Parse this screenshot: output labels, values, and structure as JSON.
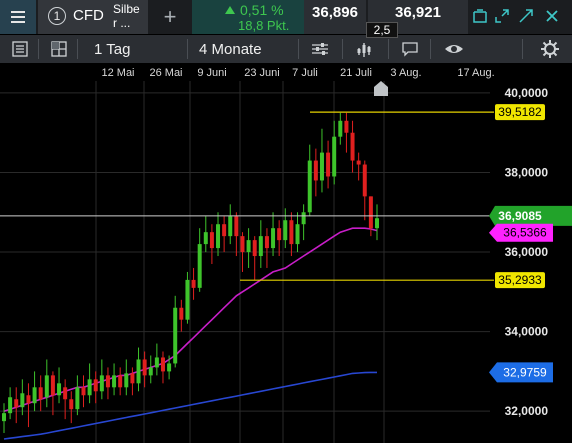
{
  "header": {
    "instrument_number": "1",
    "instrument_type": "CFD",
    "instrument_name": "Silbe\nr ...",
    "change_percent": "0,51 %",
    "change_points": "18,8 Pkt.",
    "sell_price": "36,896",
    "buy_price": "36,921",
    "spread": "2,5",
    "up_color": "#3ec74f"
  },
  "toolbar": {
    "interval": "1 Tag",
    "range": "4 Monate",
    "icons": [
      "list-icon",
      "layout-icon",
      "indicator-sliders-icon",
      "drawing-tool-icon",
      "comment-icon",
      "eye-icon",
      "settings-gear-icon"
    ]
  },
  "chart_data": {
    "type": "candlestick",
    "x_tick_labels": [
      "12 Mai",
      "26 Mai",
      "9 Juni",
      "23 Juni",
      "7 Juli",
      "21 Juli",
      "3 Aug.",
      "17 Aug."
    ],
    "y_tick_labels": [
      "40,0000",
      "38,0000",
      "36,0000",
      "34,0000",
      "32,0000"
    ],
    "y_ticks": [
      40,
      38,
      36,
      34,
      32
    ],
    "ylim": [
      31.2,
      40.3
    ],
    "price_labels": {
      "high_line": "39,5182",
      "current": "36,9085",
      "ma_fast": "36,5366",
      "low_line": "35,2933",
      "ma_slow": "32,9759"
    },
    "levels": {
      "high_line": 39.5182,
      "current": 36.9085,
      "ma_fast": 36.5366,
      "low_line": 35.2933,
      "ma_slow": 32.9759
    },
    "colors": {
      "up": "#3ec42b",
      "down": "#e0201f",
      "ma_fast": "#c81ec8",
      "ma_slow": "#2847d2",
      "level_line": "#e6d200",
      "current_label": "#22a32a",
      "ma_fast_label": "#ff22ff",
      "ma_slow_label": "#1d6de6",
      "level_label": "#f0e600"
    },
    "candles": [
      [
        31.75,
        31.95,
        31.45,
        32.2
      ],
      [
        31.95,
        32.35,
        31.8,
        32.6
      ],
      [
        32.3,
        32.1,
        31.7,
        32.6
      ],
      [
        32.1,
        32.45,
        31.9,
        32.8
      ],
      [
        32.4,
        32.2,
        31.6,
        32.7
      ],
      [
        32.2,
        32.6,
        32.0,
        33.0
      ],
      [
        32.6,
        32.3,
        32.0,
        32.9
      ],
      [
        32.35,
        32.9,
        32.1,
        33.3
      ],
      [
        32.9,
        32.4,
        31.9,
        33.0
      ],
      [
        32.4,
        32.7,
        32.2,
        33.1
      ],
      [
        32.6,
        32.3,
        31.8,
        32.8
      ],
      [
        32.3,
        32.05,
        31.7,
        32.5
      ],
      [
        32.05,
        32.6,
        31.9,
        32.9
      ],
      [
        32.6,
        32.4,
        32.1,
        32.9
      ],
      [
        32.4,
        32.8,
        32.2,
        33.2
      ],
      [
        32.8,
        32.5,
        32.2,
        33.0
      ],
      [
        32.5,
        32.9,
        32.3,
        33.3
      ],
      [
        32.9,
        32.6,
        32.3,
        33.1
      ],
      [
        32.6,
        32.9,
        32.4,
        33.2
      ],
      [
        32.9,
        32.6,
        32.4,
        33.1
      ],
      [
        32.6,
        32.95,
        32.4,
        33.3
      ],
      [
        32.95,
        32.7,
        32.4,
        33.1
      ],
      [
        32.7,
        33.3,
        32.5,
        33.6
      ],
      [
        33.3,
        32.9,
        32.6,
        33.5
      ],
      [
        32.9,
        33.1,
        32.7,
        33.4
      ],
      [
        33.1,
        33.35,
        32.9,
        33.7
      ],
      [
        33.35,
        33.0,
        32.7,
        33.5
      ],
      [
        33.0,
        33.2,
        32.8,
        33.4
      ],
      [
        33.2,
        34.6,
        33.1,
        34.9
      ],
      [
        34.6,
        34.3,
        34.0,
        34.8
      ],
      [
        34.3,
        35.3,
        34.2,
        35.5
      ],
      [
        35.3,
        35.1,
        34.8,
        35.6
      ],
      [
        35.1,
        36.2,
        35.0,
        36.6
      ],
      [
        36.2,
        36.5,
        36.0,
        36.9
      ],
      [
        36.5,
        36.1,
        35.7,
        36.7
      ],
      [
        36.1,
        36.7,
        35.9,
        37.0
      ],
      [
        36.7,
        36.4,
        36.0,
        36.9
      ],
      [
        36.4,
        36.9,
        36.2,
        37.2
      ],
      [
        36.9,
        36.4,
        35.9,
        37.0
      ],
      [
        36.4,
        36.0,
        35.5,
        36.5
      ],
      [
        36.0,
        36.3,
        35.6,
        36.6
      ],
      [
        36.3,
        35.9,
        35.3,
        36.4
      ],
      [
        35.9,
        36.4,
        35.6,
        36.8
      ],
      [
        36.4,
        36.1,
        35.6,
        36.6
      ],
      [
        36.1,
        36.6,
        35.9,
        37.0
      ],
      [
        36.6,
        36.3,
        35.9,
        36.8
      ],
      [
        36.3,
        36.8,
        36.1,
        37.1
      ],
      [
        36.8,
        36.2,
        35.9,
        37.0
      ],
      [
        36.2,
        36.7,
        36.0,
        37.0
      ],
      [
        36.7,
        37.0,
        36.3,
        37.2
      ],
      [
        37.0,
        38.3,
        36.9,
        38.7
      ],
      [
        38.3,
        37.8,
        37.4,
        38.6
      ],
      [
        37.8,
        38.5,
        37.5,
        39.1
      ],
      [
        38.5,
        37.9,
        37.6,
        38.8
      ],
      [
        37.9,
        38.9,
        37.7,
        39.3
      ],
      [
        38.9,
        39.3,
        38.7,
        39.5
      ],
      [
        39.3,
        39.0,
        38.5,
        39.5
      ],
      [
        39.0,
        38.3,
        38.0,
        39.3
      ],
      [
        38.3,
        38.2,
        37.8,
        38.5
      ],
      [
        38.2,
        37.4,
        36.8,
        38.3
      ],
      [
        37.4,
        36.6,
        36.4,
        37.4
      ],
      [
        36.6,
        36.85,
        36.3,
        37.2
      ]
    ],
    "ma_fast": [
      32.0,
      32.05,
      32.1,
      32.15,
      32.2,
      32.25,
      32.3,
      32.35,
      32.4,
      32.45,
      32.5,
      32.55,
      32.6,
      32.6,
      32.65,
      32.7,
      32.75,
      32.8,
      32.85,
      32.9,
      32.9,
      32.95,
      33.0,
      33.05,
      33.1,
      33.15,
      33.2,
      33.3,
      33.4,
      33.55,
      33.7,
      33.85,
      34.0,
      34.15,
      34.3,
      34.45,
      34.6,
      34.75,
      34.9,
      35.0,
      35.1,
      35.2,
      35.3,
      35.4,
      35.5,
      35.55,
      35.6,
      35.7,
      35.8,
      35.9,
      36.0,
      36.1,
      36.2,
      36.3,
      36.4,
      36.5,
      36.55,
      36.6,
      36.6,
      36.6,
      36.58,
      36.54
    ],
    "ma_slow": [
      31.3,
      31.32,
      31.34,
      31.36,
      31.38,
      31.4,
      31.42,
      31.45,
      31.48,
      31.51,
      31.54,
      31.57,
      31.6,
      31.63,
      31.66,
      31.69,
      31.72,
      31.75,
      31.78,
      31.81,
      31.84,
      31.87,
      31.9,
      31.93,
      31.96,
      31.99,
      32.02,
      32.05,
      32.08,
      32.11,
      32.14,
      32.17,
      32.2,
      32.23,
      32.26,
      32.29,
      32.32,
      32.35,
      32.38,
      32.41,
      32.44,
      32.47,
      32.5,
      32.53,
      32.56,
      32.59,
      32.62,
      32.65,
      32.68,
      32.71,
      32.74,
      32.77,
      32.8,
      32.83,
      32.86,
      32.89,
      32.92,
      32.95,
      32.96,
      32.97,
      32.975,
      32.976
    ]
  }
}
